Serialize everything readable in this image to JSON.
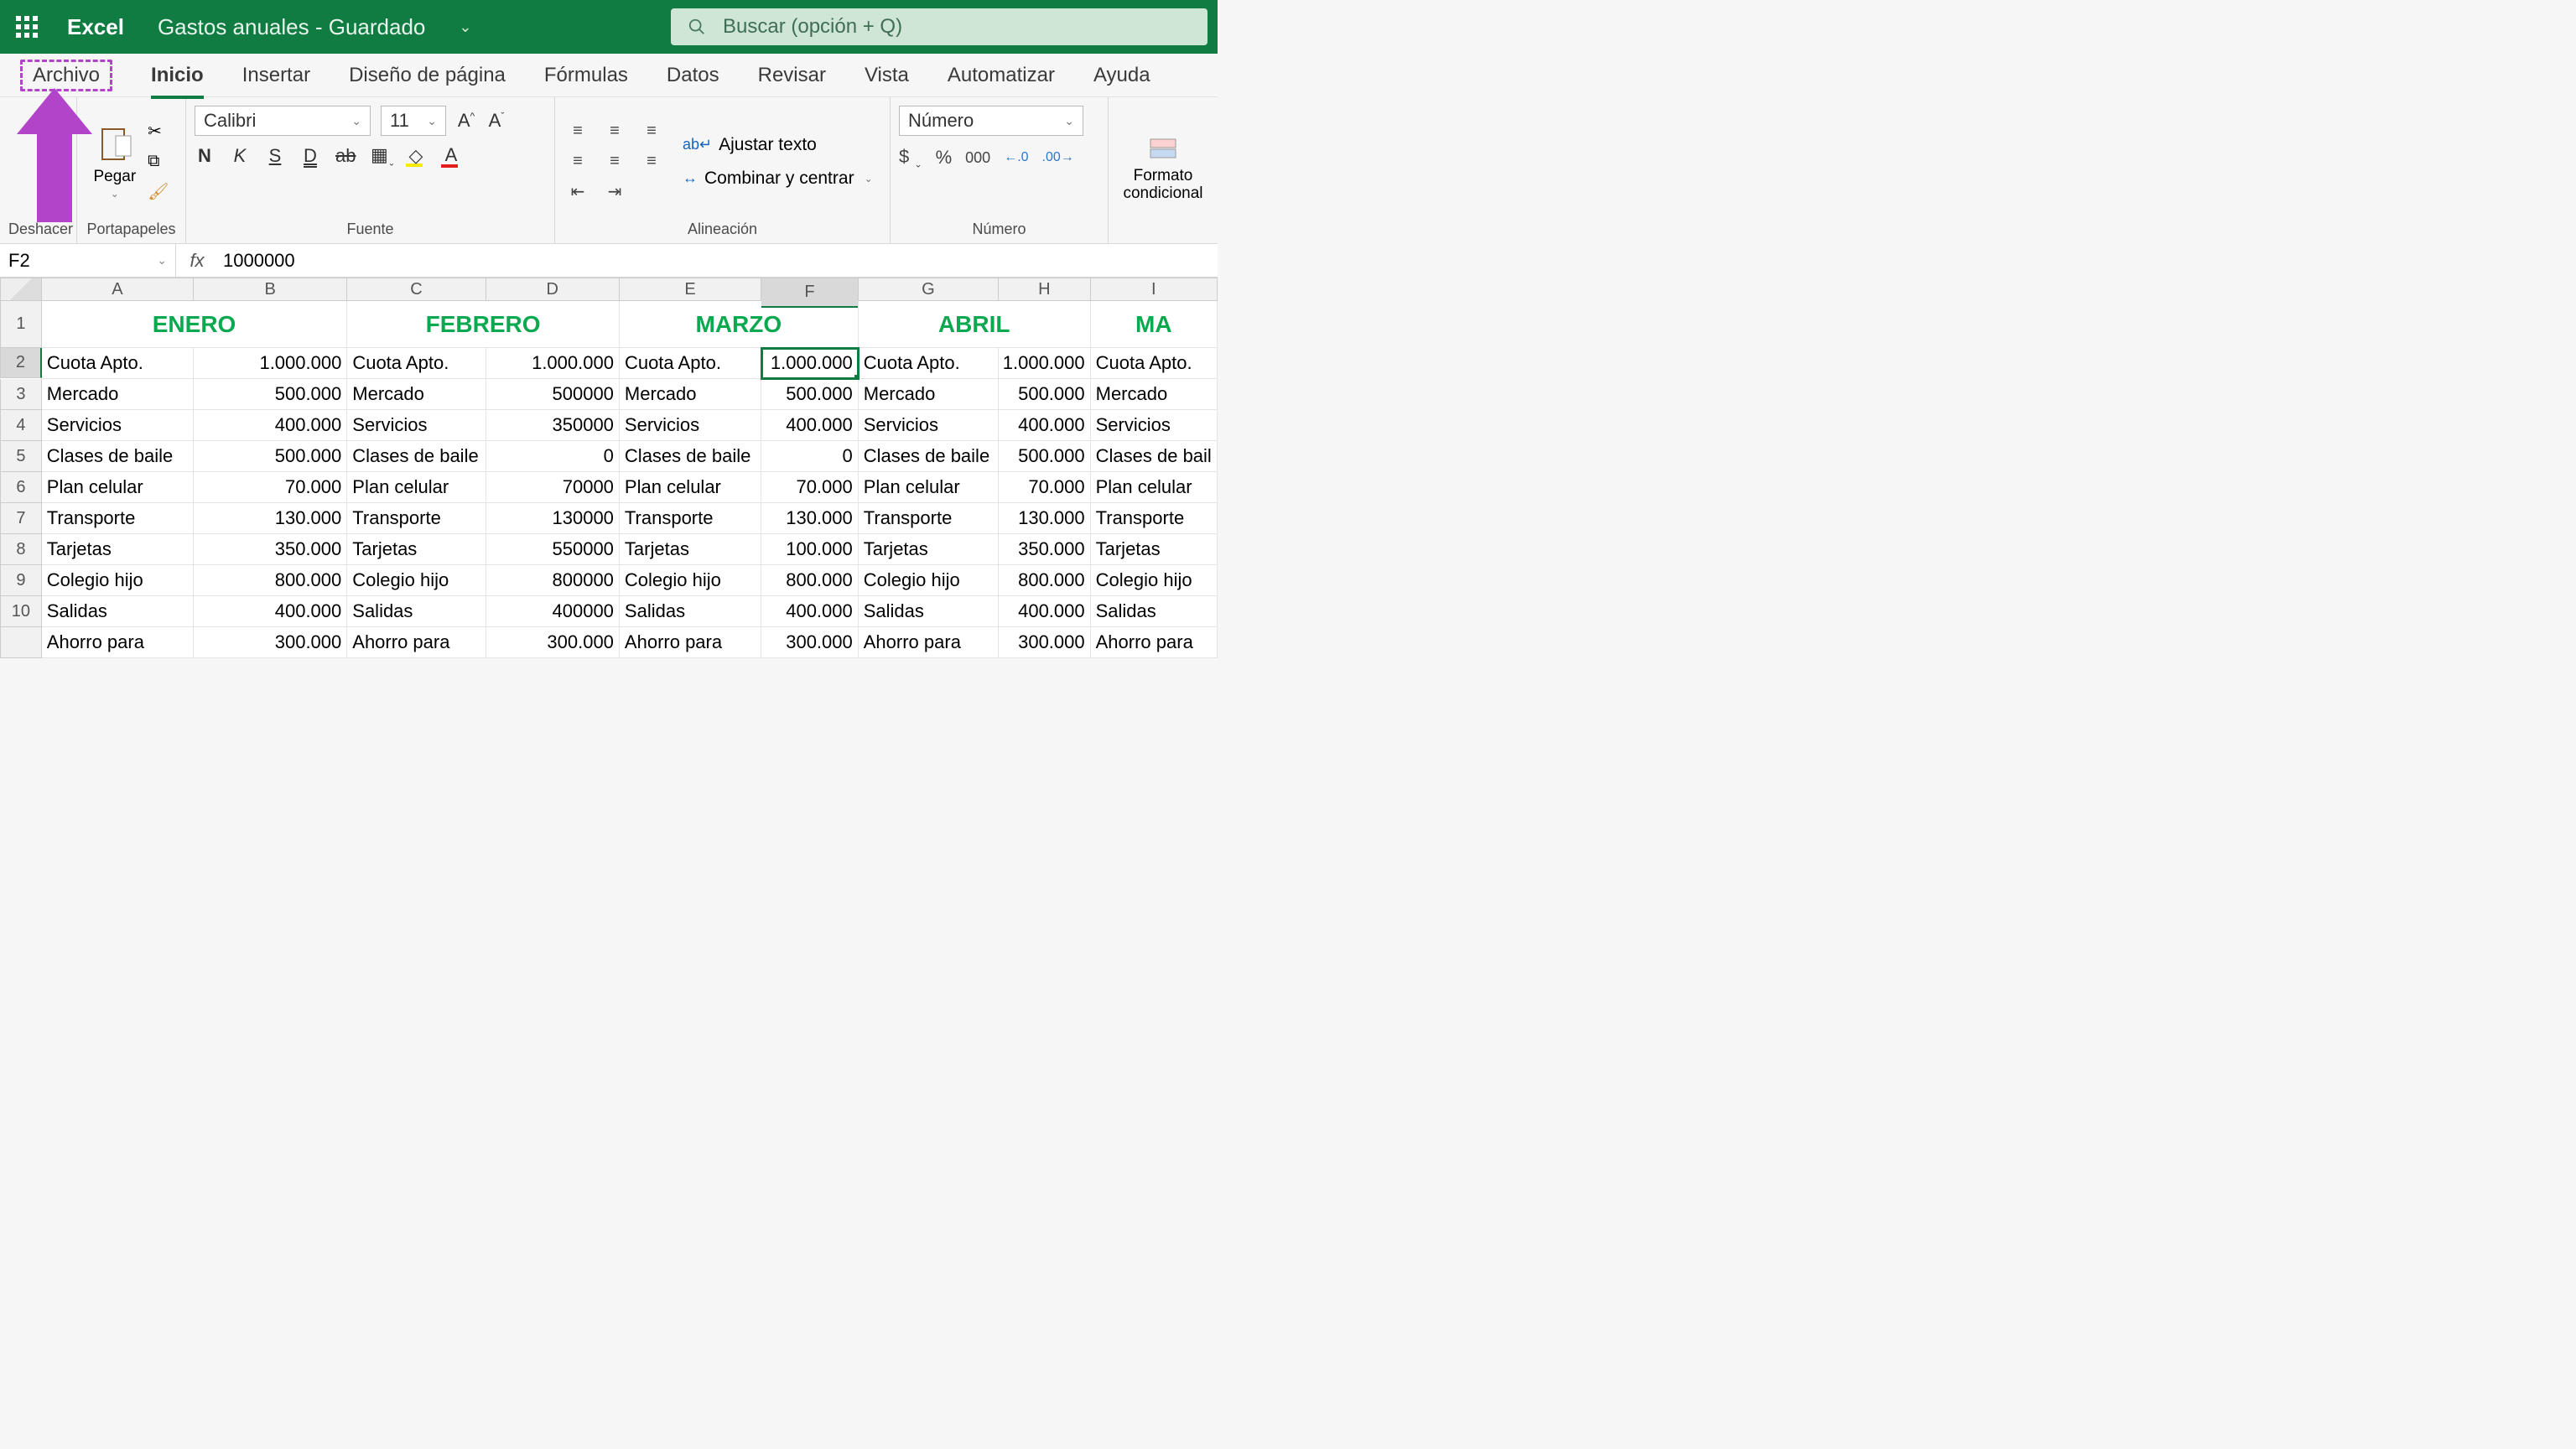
{
  "app_name": "Excel",
  "doc_name": "Gastos anuales  -  Guardado",
  "search_placeholder": "Buscar (opción + Q)",
  "tabs": [
    "Archivo",
    "Inicio",
    "Insertar",
    "Diseño de página",
    "Fórmulas",
    "Datos",
    "Revisar",
    "Vista",
    "Automatizar",
    "Ayuda"
  ],
  "ribbon": {
    "undo_label": "Deshacer",
    "clipboard_label": "Portapapeles",
    "paste_label": "Pegar",
    "font_label": "Fuente",
    "font_name": "Calibri",
    "font_size": "11",
    "align_label": "Alineación",
    "wrap_text": "Ajustar texto",
    "merge_center": "Combinar y centrar",
    "number_label": "Número",
    "number_format": "Número",
    "cond_fmt": "Formato condicional"
  },
  "namebox": "F2",
  "formula": "1000000",
  "columns": [
    "A",
    "B",
    "C",
    "D",
    "E",
    "F",
    "G",
    "H",
    "I"
  ],
  "col_widths": [
    "col-A2",
    "col-B",
    "col-C",
    "col-D",
    "col-E",
    "col-F",
    "col-G",
    "col-H",
    "col-I"
  ],
  "months": [
    "ENERO",
    "",
    "FEBRERO",
    "",
    "MARZO",
    "",
    "ABRIL",
    "",
    "MA"
  ],
  "month_span_cols": [
    [
      "col-A2",
      "col-B"
    ],
    [
      "col-C",
      "col-D"
    ],
    [
      "col-E",
      "col-F"
    ],
    [
      "col-G",
      "col-H"
    ],
    [
      "col-I"
    ]
  ],
  "rows": [
    {
      "n": 2,
      "cells": [
        "Cuota Apto.",
        "1.000.000",
        "Cuota Apto.",
        "1.000.000",
        "Cuota Apto.",
        "1.000.000",
        "Cuota Apto.",
        "1.000.000",
        "Cuota Apto."
      ]
    },
    {
      "n": 3,
      "cells": [
        "Mercado",
        "500.000",
        "Mercado",
        "500000",
        "Mercado",
        "500.000",
        "Mercado",
        "500.000",
        "Mercado"
      ]
    },
    {
      "n": 4,
      "cells": [
        "Servicios",
        "400.000",
        "Servicios",
        "350000",
        "Servicios",
        "400.000",
        "Servicios",
        "400.000",
        "Servicios"
      ]
    },
    {
      "n": 5,
      "cells": [
        "Clases de baile",
        "500.000",
        "Clases de baile",
        "0",
        "Clases de baile",
        "0",
        "Clases de baile",
        "500.000",
        "Clases de bail"
      ]
    },
    {
      "n": 6,
      "cells": [
        "Plan celular",
        "70.000",
        "Plan celular",
        "70000",
        "Plan celular",
        "70.000",
        "Plan celular",
        "70.000",
        "Plan celular"
      ]
    },
    {
      "n": 7,
      "cells": [
        "Transporte",
        "130.000",
        "Transporte",
        "130000",
        "Transporte",
        "130.000",
        "Transporte",
        "130.000",
        "Transporte"
      ]
    },
    {
      "n": 8,
      "cells": [
        "Tarjetas",
        "350.000",
        "Tarjetas",
        "550000",
        "Tarjetas",
        "100.000",
        "Tarjetas",
        "350.000",
        "Tarjetas"
      ]
    },
    {
      "n": 9,
      "cells": [
        "Colegio hijo",
        "800.000",
        "Colegio hijo",
        "800000",
        "Colegio hijo",
        "800.000",
        "Colegio hijo",
        "800.000",
        "Colegio hijo"
      ]
    },
    {
      "n": 10,
      "cells": [
        "Salidas",
        "400.000",
        "Salidas",
        "400000",
        "Salidas",
        "400.000",
        "Salidas",
        "400.000",
        "Salidas"
      ]
    },
    {
      "n": "",
      "cells": [
        "Ahorro para",
        "300.000",
        "Ahorro para",
        "300.000",
        "Ahorro para",
        "300.000",
        "Ahorro para",
        "300.000",
        "Ahorro para"
      ]
    }
  ],
  "selected": {
    "row": 2,
    "col": 5
  }
}
